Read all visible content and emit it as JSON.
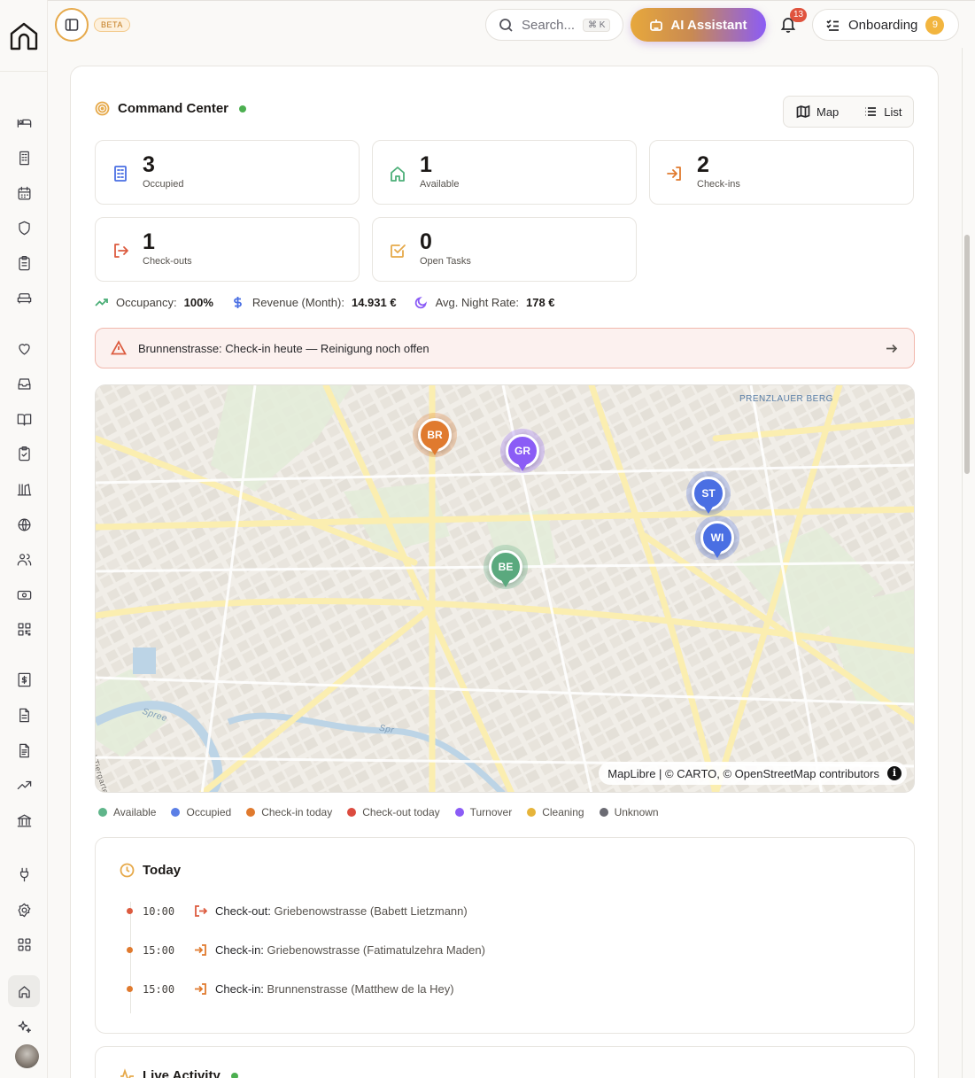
{
  "header": {
    "beta": "BETA",
    "search_placeholder": "Search...",
    "search_shortcut": "⌘ K",
    "ai_label": "AI Assistant",
    "notifications": "13",
    "onboarding_label": "Onboarding",
    "onboarding_count": "9"
  },
  "command_center": {
    "title": "Command Center",
    "view_map": "Map",
    "view_list": "List",
    "stats": [
      {
        "value": "3",
        "label": "Occupied",
        "icon": "building-icon",
        "color": "#4a6fe3"
      },
      {
        "value": "1",
        "label": "Available",
        "icon": "home-icon",
        "color": "#4caf78"
      },
      {
        "value": "2",
        "label": "Check-ins",
        "icon": "login-icon",
        "color": "#e07a2e"
      },
      {
        "value": "1",
        "label": "Check-outs",
        "icon": "logout-icon",
        "color": "#dc5b3f"
      },
      {
        "value": "0",
        "label": "Open Tasks",
        "icon": "checkbox-icon",
        "color": "#e6a94a"
      }
    ],
    "kpis": {
      "occupancy_label": "Occupancy:",
      "occupancy_value": "100%",
      "revenue_label": "Revenue (Month):",
      "revenue_value": "14.931 €",
      "rate_label": "Avg. Night Rate:",
      "rate_value": "178 €"
    },
    "alert": "Brunnenstrasse: Check-in heute — Reinigung noch offen"
  },
  "map": {
    "district_label": "PRENZLAUER BERG",
    "attribution": "MapLibre | © CARTO, © OpenStreetMap contributors",
    "info": "i",
    "pins": [
      {
        "code": "BR",
        "color": "#e07a2e",
        "glow": "rgba(224,122,46,0.28)"
      },
      {
        "code": "GR",
        "color": "#8b5cf6",
        "glow": "rgba(139,92,246,0.28)"
      },
      {
        "code": "ST",
        "color": "#4a6fe3",
        "glow": "rgba(74,111,227,0.28)"
      },
      {
        "code": "WI",
        "color": "#4a6fe3",
        "glow": "rgba(74,111,227,0.28)"
      },
      {
        "code": "BE",
        "color": "#5aa97e",
        "glow": "rgba(90,169,126,0.28)"
      }
    ],
    "street_labels": [
      "Spree",
      "Spr",
      "Tunnel Tiergarten Spreebo"
    ]
  },
  "legend": [
    {
      "label": "Available",
      "color": "#5fb58a"
    },
    {
      "label": "Occupied",
      "color": "#5b7fe6"
    },
    {
      "label": "Check-in today",
      "color": "#e07a2e"
    },
    {
      "label": "Check-out today",
      "color": "#dc4b3f"
    },
    {
      "label": "Turnover",
      "color": "#8b5cf6"
    },
    {
      "label": "Cleaning",
      "color": "#e6b43a"
    },
    {
      "label": "Unknown",
      "color": "#6b6b73"
    }
  ],
  "today": {
    "title": "Today",
    "events": [
      {
        "time": "10:00",
        "type": "Check-out:",
        "detail": "Griebenowstrasse (Babett Lietzmann)",
        "color": "#dc5b3f"
      },
      {
        "time": "15:00",
        "type": "Check-in:",
        "detail": "Griebenowstrasse (Fatimatulzehra Maden)",
        "color": "#e07a2e"
      },
      {
        "time": "15:00",
        "type": "Check-in:",
        "detail": "Brunnenstrasse (Matthew de la Hey)",
        "color": "#e07a2e"
      }
    ]
  },
  "live_activity": {
    "title": "Live Activity"
  }
}
